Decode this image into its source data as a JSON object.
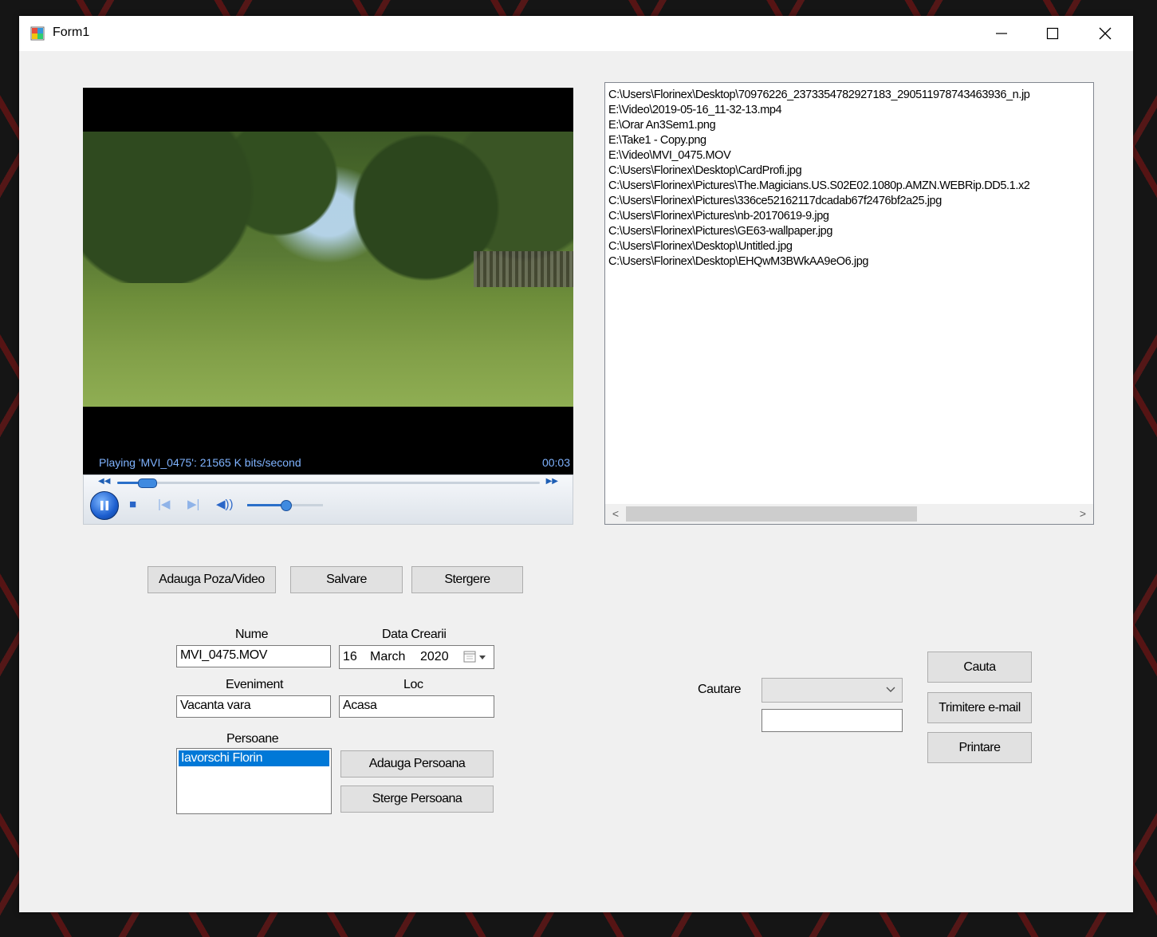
{
  "window": {
    "title": "Form1"
  },
  "player": {
    "status": "Playing 'MVI_0475': 21565 K bits/second",
    "time": "00:03",
    "seek_progress": 0.07,
    "volume_level": 0.5
  },
  "files": {
    "items": [
      "C:\\Users\\Florinex\\Desktop\\70976226_2373354782927183_290511978743463936_n.jp",
      "E:\\Video\\2019-05-16_11-32-13.mp4",
      "E:\\Orar An3Sem1.png",
      "E:\\Take1 - Copy.png",
      "E:\\Video\\MVI_0475.MOV",
      "C:\\Users\\Florinex\\Desktop\\CardProfi.jpg",
      "C:\\Users\\Florinex\\Pictures\\The.Magicians.US.S02E02.1080p.AMZN.WEBRip.DD5.1.x2",
      "C:\\Users\\Florinex\\Pictures\\336ce52162117dcadab67f2476bf2a25.jpg",
      "C:\\Users\\Florinex\\Pictures\\nb-20170619-9.jpg",
      "C:\\Users\\Florinex\\Pictures\\GE63-wallpaper.jpg",
      "C:\\Users\\Florinex\\Desktop\\Untitled.jpg",
      "C:\\Users\\Florinex\\Desktop\\EHQwM3BWkAA9eO6.jpg"
    ]
  },
  "actions": {
    "add_media": "Adauga Poza/Video",
    "save": "Salvare",
    "delete": "Stergere"
  },
  "form": {
    "name_label": "Nume",
    "name_value": "MVI_0475.MOV",
    "date_label": "Data Crearii",
    "date_day": "16",
    "date_month": "March",
    "date_year": "2020",
    "event_label": "Eveniment",
    "event_value": "Vacanta vara",
    "place_label": "Loc",
    "place_value": "Acasa",
    "persons_label": "Persoane",
    "persons": [
      "Iavorschi Florin"
    ],
    "add_person": "Adauga Persoana",
    "remove_person": "Sterge Persoana"
  },
  "search": {
    "label": "Cautare",
    "combo_value": "",
    "text_value": "",
    "search_button": "Cauta",
    "email_button": "Trimitere e-mail",
    "print_button": "Printare"
  },
  "colors": {
    "selection": "#0078d7",
    "window_bg": "#f0f0f0",
    "status_text": "#7fb3ff"
  }
}
